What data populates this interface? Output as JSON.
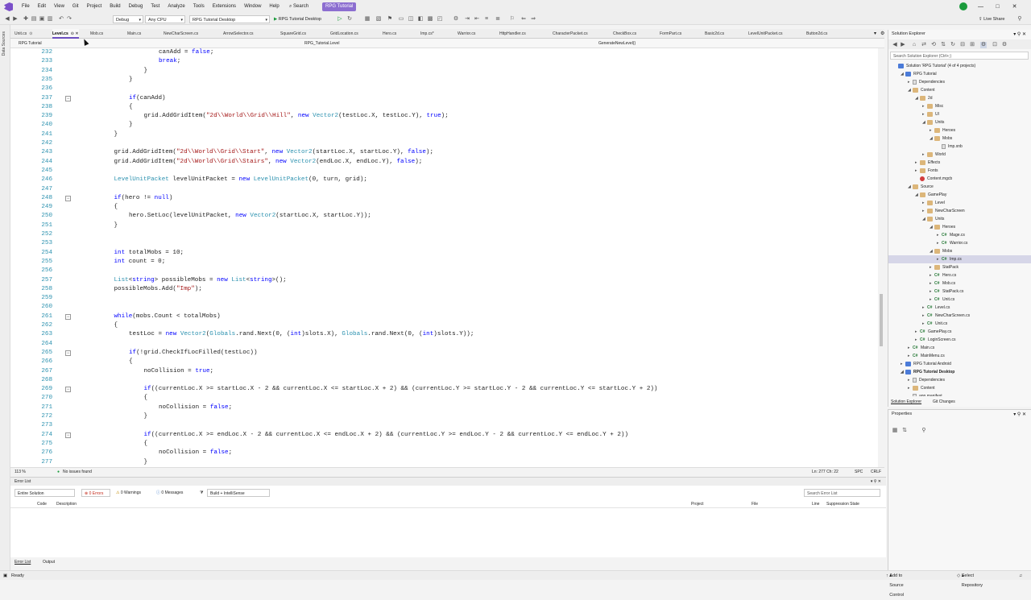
{
  "menu": [
    "File",
    "Edit",
    "View",
    "Git",
    "Project",
    "Build",
    "Debug",
    "Test",
    "Analyze",
    "Tools",
    "Extensions",
    "Window",
    "Help"
  ],
  "search_label": "Search",
  "solution_badge": "RPG Tutorial",
  "window_controls": [
    "—",
    "□",
    "✕"
  ],
  "toolbar": {
    "config": "Debug",
    "platform": "Any CPU",
    "startup": "RPG Tutorial Desktop",
    "run_label": "RPG Tutorial Desktop",
    "live_share": "Live Share"
  },
  "left_strip": [
    "Data Sources"
  ],
  "tabs": [
    {
      "label": "Unit.cs",
      "active": false
    },
    {
      "label": "Level.cs",
      "active": true
    },
    {
      "label": "Mob.cs",
      "active": false
    },
    {
      "label": "Main.cs",
      "active": false
    },
    {
      "label": "NewCharScreen.cs",
      "active": false
    },
    {
      "label": "ArrowSelector.cs",
      "active": false
    },
    {
      "label": "SquareGrid.cs",
      "active": false
    },
    {
      "label": "GridLocation.cs",
      "active": false
    },
    {
      "label": "Hero.cs",
      "active": false
    },
    {
      "label": "Imp.cs*",
      "active": false
    },
    {
      "label": "Warrior.cs",
      "active": false
    },
    {
      "label": "HttpHandler.cs",
      "active": false
    },
    {
      "label": "CharacterPacket.cs",
      "active": false
    },
    {
      "label": "CheckBox.cs",
      "active": false
    },
    {
      "label": "FormPart.cs",
      "active": false
    },
    {
      "label": "Basic2d.cs",
      "active": false
    },
    {
      "label": "LevelUnitPacket.cs",
      "active": false
    },
    {
      "label": "Button2d.cs",
      "active": false
    }
  ],
  "navbar": {
    "project": "RPG Tutorial",
    "type": "RPG_Tutorial.Level",
    "member": "GenerateNewLevel()"
  },
  "code_lines": [
    {
      "n": "232",
      "indent": 6,
      "html": "canAdd = <span class=\"kw\">false</span>;"
    },
    {
      "n": "233",
      "indent": 6,
      "html": "<span class=\"kw\">break</span>;"
    },
    {
      "n": "234",
      "indent": 5,
      "html": "}"
    },
    {
      "n": "235",
      "indent": 4,
      "html": "}"
    },
    {
      "n": "236",
      "indent": 0,
      "html": ""
    },
    {
      "n": "237",
      "indent": 4,
      "html": "<span class=\"kw\">if</span>(canAdd)",
      "fold": true
    },
    {
      "n": "238",
      "indent": 4,
      "html": "{"
    },
    {
      "n": "239",
      "indent": 5,
      "html": "grid.AddGridItem(<span class=\"st\">\"2d\\\\World\\\\Grid\\\\Hill\"</span>, <span class=\"kw\">new</span> <span class=\"ty\">Vector2</span>(testLoc.X, testLoc.Y), <span class=\"kw\">true</span>);"
    },
    {
      "n": "240",
      "indent": 4,
      "html": "}"
    },
    {
      "n": "241",
      "indent": 3,
      "html": "}"
    },
    {
      "n": "242",
      "indent": 0,
      "html": ""
    },
    {
      "n": "243",
      "indent": 3,
      "html": "grid.AddGridItem(<span class=\"st\">\"2d\\\\World\\\\Grid\\\\Start\"</span>, <span class=\"kw\">new</span> <span class=\"ty\">Vector2</span>(startLoc.X, startLoc.Y), <span class=\"kw\">false</span>);"
    },
    {
      "n": "244",
      "indent": 3,
      "html": "grid.AddGridItem(<span class=\"st\">\"2d\\\\World\\\\Grid\\\\Stairs\"</span>, <span class=\"kw\">new</span> <span class=\"ty\">Vector2</span>(endLoc.X, endLoc.Y), <span class=\"kw\">false</span>);"
    },
    {
      "n": "245",
      "indent": 0,
      "html": ""
    },
    {
      "n": "246",
      "indent": 3,
      "html": "<span class=\"ty\">LevelUnitPacket</span> levelUnitPacket = <span class=\"kw\">new</span> <span class=\"ty\">LevelUnitPacket</span>(0, turn, grid);"
    },
    {
      "n": "247",
      "indent": 0,
      "html": ""
    },
    {
      "n": "248",
      "indent": 3,
      "html": "<span class=\"kw\">if</span>(hero != <span class=\"kw\">null</span>)",
      "fold": true
    },
    {
      "n": "249",
      "indent": 3,
      "html": "{"
    },
    {
      "n": "250",
      "indent": 4,
      "html": "hero.SetLoc(levelUnitPacket, <span class=\"kw\">new</span> <span class=\"ty\">Vector2</span>(startLoc.X, startLoc.Y));"
    },
    {
      "n": "251",
      "indent": 3,
      "html": "}"
    },
    {
      "n": "252",
      "indent": 0,
      "html": ""
    },
    {
      "n": "253",
      "indent": 0,
      "html": ""
    },
    {
      "n": "254",
      "indent": 3,
      "html": "<span class=\"kw\">int</span> totalMobs = 10;"
    },
    {
      "n": "255",
      "indent": 3,
      "html": "<span class=\"kw\">int</span> count = 0;"
    },
    {
      "n": "256",
      "indent": 0,
      "html": ""
    },
    {
      "n": "257",
      "indent": 3,
      "html": "<span class=\"ty\">List</span>&lt;<span class=\"kw\">string</span>&gt; possibleMobs = <span class=\"kw\">new</span> <span class=\"ty\">List</span>&lt;<span class=\"kw\">string</span>&gt;();"
    },
    {
      "n": "258",
      "indent": 3,
      "html": "possibleMobs.Add(<span class=\"st\">\"Imp\"</span>);"
    },
    {
      "n": "259",
      "indent": 0,
      "html": ""
    },
    {
      "n": "260",
      "indent": 0,
      "html": ""
    },
    {
      "n": "261",
      "indent": 3,
      "html": "<span class=\"kw\">while</span>(mobs.Count &lt; totalMobs)",
      "fold": true
    },
    {
      "n": "262",
      "indent": 3,
      "html": "{"
    },
    {
      "n": "263",
      "indent": 4,
      "html": "testLoc = <span class=\"kw\">new</span> <span class=\"ty\">Vector2</span>(<span class=\"ty\">Globals</span>.rand.Next(0, (<span class=\"kw\">int</span>)slots.X), <span class=\"ty\">Globals</span>.rand.Next(0, (<span class=\"kw\">int</span>)slots.Y));"
    },
    {
      "n": "264",
      "indent": 0,
      "html": ""
    },
    {
      "n": "265",
      "indent": 4,
      "html": "<span class=\"kw\">if</span>(!grid.CheckIfLocFilled(testLoc))",
      "fold": true
    },
    {
      "n": "266",
      "indent": 4,
      "html": "{"
    },
    {
      "n": "267",
      "indent": 5,
      "html": "noCollision = <span class=\"kw\">true</span>;"
    },
    {
      "n": "268",
      "indent": 0,
      "html": ""
    },
    {
      "n": "269",
      "indent": 5,
      "html": "<span class=\"kw\">if</span>((currentLoc.X &gt;= startLoc.X - 2 &amp;&amp; currentLoc.X &lt;= startLoc.X + 2) &amp;&amp; (currentLoc.Y &gt;= startLoc.Y - 2 &amp;&amp; currentLoc.Y &lt;= startLoc.Y + 2))",
      "fold": true
    },
    {
      "n": "270",
      "indent": 5,
      "html": "{"
    },
    {
      "n": "271",
      "indent": 6,
      "html": "noCollision = <span class=\"kw\">false</span>;"
    },
    {
      "n": "272",
      "indent": 5,
      "html": "}"
    },
    {
      "n": "273",
      "indent": 0,
      "html": ""
    },
    {
      "n": "274",
      "indent": 5,
      "html": "<span class=\"kw\">if</span>((currentLoc.X &gt;= endLoc.X - 2 &amp;&amp; currentLoc.X &lt;= endLoc.X + 2) &amp;&amp; (currentLoc.Y &gt;= endLoc.Y - 2 &amp;&amp; currentLoc.Y &lt;= endLoc.Y + 2))",
      "fold": true
    },
    {
      "n": "275",
      "indent": 5,
      "html": "{"
    },
    {
      "n": "276",
      "indent": 6,
      "html": "noCollision = <span class=\"kw\">false</span>;"
    },
    {
      "n": "277",
      "indent": 5,
      "html": "}"
    }
  ],
  "editor_status": {
    "zoom": "113 %",
    "issues": "No issues found",
    "position": "Ln: 277   Ch: 22",
    "encoding": "SPC",
    "line_ending": "CRLF"
  },
  "error_list": {
    "title": "Error List",
    "scope": "Entire Solution",
    "errors": "0 Errors",
    "warnings": "0 Warnings",
    "messages": "0 Messages",
    "build_filter": "Build + IntelliSense",
    "search_placeholder": "Search Error List",
    "columns": [
      "Code",
      "Description",
      "Project",
      "File",
      "Line",
      "Suppression State"
    ]
  },
  "bottom_tabs": [
    "Error List",
    "Output"
  ],
  "solution_explorer": {
    "title": "Solution Explorer",
    "search_placeholder": "Search Solution Explorer (Ctrl+;)",
    "footer_tabs": [
      "Solution Explorer",
      "Git Changes"
    ],
    "tree": [
      {
        "label": "Solution 'RPG Tutorial' (4 of 4 projects)",
        "depth": 0,
        "icon": "proj",
        "arrow": ""
      },
      {
        "label": "RPG Tutorial",
        "depth": 1,
        "icon": "proj",
        "arrow": "◢"
      },
      {
        "label": "Dependencies",
        "depth": 2,
        "icon": "file",
        "arrow": "▸"
      },
      {
        "label": "Content",
        "depth": 2,
        "icon": "folder",
        "arrow": "◢"
      },
      {
        "label": "2d",
        "depth": 3,
        "icon": "folder",
        "arrow": "◢"
      },
      {
        "label": "Misc",
        "depth": 4,
        "icon": "folder",
        "arrow": "▸"
      },
      {
        "label": "UI",
        "depth": 4,
        "icon": "folder",
        "arrow": "▸"
      },
      {
        "label": "Units",
        "depth": 4,
        "icon": "folder",
        "arrow": "◢"
      },
      {
        "label": "Heroes",
        "depth": 5,
        "icon": "folder",
        "arrow": "▸"
      },
      {
        "label": "Mobs",
        "depth": 5,
        "icon": "folder",
        "arrow": "◢"
      },
      {
        "label": "Imp.xnb",
        "depth": 6,
        "icon": "file",
        "arrow": ""
      },
      {
        "label": "World",
        "depth": 4,
        "icon": "folder",
        "arrow": "▸"
      },
      {
        "label": "Effects",
        "depth": 3,
        "icon": "folder",
        "arrow": "▸"
      },
      {
        "label": "Fonts",
        "depth": 3,
        "icon": "folder",
        "arrow": "▸"
      },
      {
        "label": "Content.mgcb",
        "depth": 3,
        "icon": "red",
        "arrow": ""
      },
      {
        "label": "Source",
        "depth": 2,
        "icon": "folder",
        "arrow": "◢"
      },
      {
        "label": "GamePlay",
        "depth": 3,
        "icon": "folder",
        "arrow": "◢"
      },
      {
        "label": "Level",
        "depth": 4,
        "icon": "folder",
        "arrow": "▸"
      },
      {
        "label": "NewCharScreen",
        "depth": 4,
        "icon": "folder",
        "arrow": "▸"
      },
      {
        "label": "Units",
        "depth": 4,
        "icon": "folder",
        "arrow": "◢"
      },
      {
        "label": "Heroes",
        "depth": 5,
        "icon": "folder",
        "arrow": "◢"
      },
      {
        "label": "Mage.cs",
        "depth": 6,
        "icon": "cs",
        "arrow": "▸"
      },
      {
        "label": "Warrior.cs",
        "depth": 6,
        "icon": "cs",
        "arrow": "▸"
      },
      {
        "label": "Mobs",
        "depth": 5,
        "icon": "folder",
        "arrow": "◢"
      },
      {
        "label": "Imp.cs",
        "depth": 6,
        "icon": "cs",
        "arrow": "▸",
        "selected": true
      },
      {
        "label": "StatPack",
        "depth": 5,
        "icon": "folder",
        "arrow": "▸"
      },
      {
        "label": "Hero.cs",
        "depth": 5,
        "icon": "cs",
        "arrow": "▸"
      },
      {
        "label": "Mob.cs",
        "depth": 5,
        "icon": "cs",
        "arrow": "▸"
      },
      {
        "label": "StatPack.cs",
        "depth": 5,
        "icon": "cs",
        "arrow": "▸"
      },
      {
        "label": "Unit.cs",
        "depth": 5,
        "icon": "cs",
        "arrow": "▸"
      },
      {
        "label": "Level.cs",
        "depth": 4,
        "icon": "cs",
        "arrow": "▸"
      },
      {
        "label": "NewCharScreen.cs",
        "depth": 4,
        "icon": "cs",
        "arrow": "▸"
      },
      {
        "label": "Unit.cs",
        "depth": 4,
        "icon": "cs",
        "arrow": "▸"
      },
      {
        "label": "GamePlay.cs",
        "depth": 3,
        "icon": "cs",
        "arrow": "▸"
      },
      {
        "label": "LoginScreen.cs",
        "depth": 3,
        "icon": "cs",
        "arrow": "▸"
      },
      {
        "label": "Main.cs",
        "depth": 2,
        "icon": "cs",
        "arrow": "▸"
      },
      {
        "label": "MainMenu.cs",
        "depth": 2,
        "icon": "cs",
        "arrow": "▸"
      },
      {
        "label": "RPG Tutorial Android",
        "depth": 1,
        "icon": "proj",
        "arrow": "▸"
      },
      {
        "label": "RPG Tutorial Desktop",
        "depth": 1,
        "icon": "proj",
        "arrow": "◢",
        "bold": true
      },
      {
        "label": "Dependencies",
        "depth": 2,
        "icon": "file",
        "arrow": "▸"
      },
      {
        "label": "Content",
        "depth": 2,
        "icon": "folder",
        "arrow": "▸"
      },
      {
        "label": "app.manifest",
        "depth": 2,
        "icon": "file",
        "arrow": ""
      },
      {
        "label": "Icon.bmp",
        "depth": 2,
        "icon": "file",
        "arrow": ""
      }
    ]
  },
  "properties": {
    "title": "Properties"
  },
  "statusbar": {
    "ready": "Ready",
    "source_control": "Add to Source Control",
    "repository": "Select Repository"
  },
  "colors": {
    "accent": "#6c4fc0",
    "keyword": "#0000ff",
    "type": "#2b91af",
    "string": "#a31515",
    "ok": "#1a9b3c"
  }
}
